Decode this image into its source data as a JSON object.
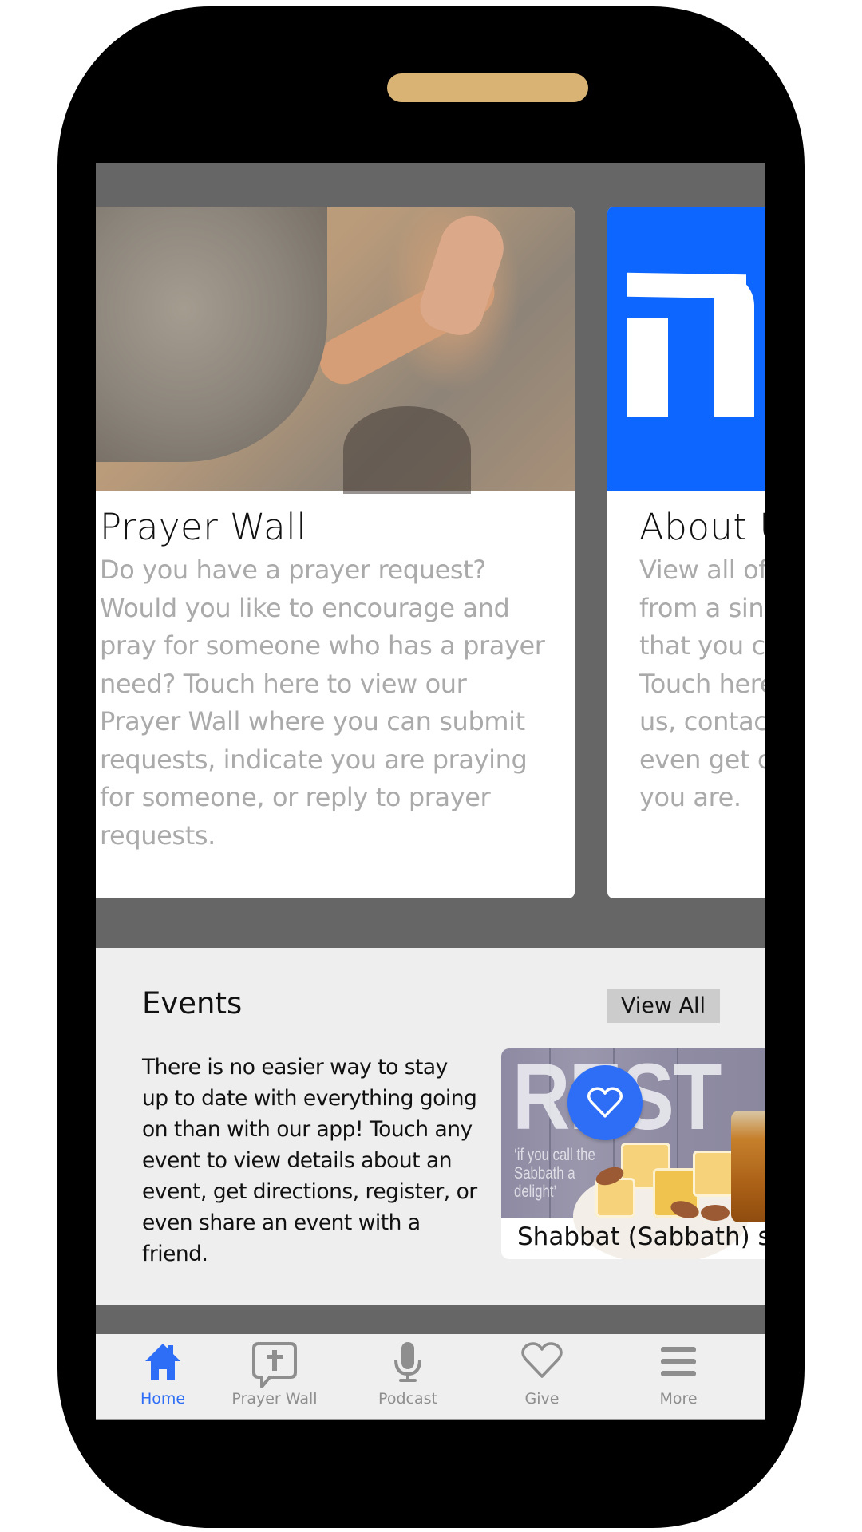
{
  "colors": {
    "accent": "#2E6EF7",
    "about_card_blue": "#0D66FF",
    "speaker": "#D9B373",
    "screen_bg": "#666666",
    "events_bg": "#EEEEEE",
    "tab_inactive": "#8E8E8E"
  },
  "cards": [
    {
      "title": "Prayer Wall",
      "description": "Do you have a prayer request? Would you like to encourage and pray for someone who has a prayer need? Touch here to view our Prayer Wall where you can submit requests, indicate you are praying for someone, or reply to prayer requests.",
      "image": "woman-praying-at-wall-photo"
    },
    {
      "title": "About Us",
      "description_lines": [
        "View all of",
        "from a sing",
        "that you ca",
        "Touch here",
        "us, contac",
        "even get c",
        "you are."
      ],
      "image": "hebrew-letter-he-logo"
    }
  ],
  "events": {
    "heading": "Events",
    "view_all_label": "View All",
    "description": "There is no easier way to stay up to date with everything going on than with our app! Touch any event to view details about an event, get directions, register, or even share an event with a friend.",
    "items": [
      {
        "title": "Shabbat (Sabbath) s...",
        "image_text": "REST",
        "image_quote": "‘if you call the\nSabbath a\ndelight’"
      }
    ]
  },
  "fab": {
    "icon": "heart-icon"
  },
  "tabbar": {
    "items": [
      {
        "label": "Home",
        "icon": "home-icon",
        "active": true
      },
      {
        "label": "Prayer Wall",
        "icon": "prayer-bubble-cross-icon",
        "active": false
      },
      {
        "label": "Podcast",
        "icon": "microphone-icon",
        "active": false
      },
      {
        "label": "Give",
        "icon": "heart-outline-icon",
        "active": false
      },
      {
        "label": "More",
        "icon": "hamburger-menu-icon",
        "active": false
      }
    ]
  }
}
